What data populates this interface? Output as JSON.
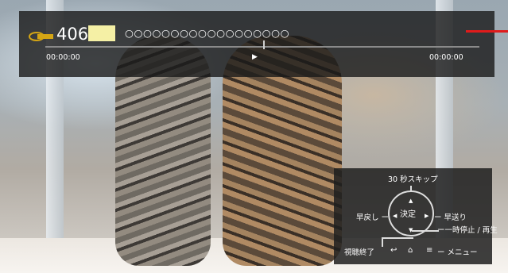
{
  "header": {
    "channel_number": "406",
    "program_title": "○○○○○○○○○○○○○○○○○○",
    "time_start": "00:00:00",
    "time_end": "00:00:00"
  },
  "guide": {
    "skip_label": "30 秒スキップ",
    "rewind_label": "早戻し ー",
    "ok_label": "決定",
    "fastforward_label": "ー 早送り",
    "pause_play_label": "ー一時停止 / 再生",
    "exit_label": "視聴終了",
    "menu_label": "ー メニュー"
  },
  "icons": [
    "g-guide-logo",
    "play-icon",
    "up-arrow-icon",
    "down-arrow-icon",
    "left-arrow-icon",
    "right-arrow-icon",
    "back-icon",
    "home-icon",
    "menu-icon"
  ],
  "colors": {
    "accent_red": "#e01b1b",
    "channel_mark": "#f5f0a5",
    "logo_gold": "#d4a514"
  }
}
